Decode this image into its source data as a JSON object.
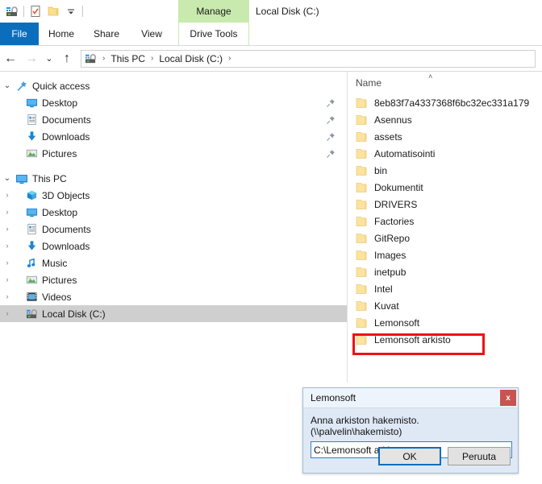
{
  "window": {
    "title": "Local Disk (C:)",
    "contextual_tab_group": "Manage",
    "quick_access_icons": [
      "drive-icon",
      "properties-icon",
      "new-folder-icon",
      "customize-chevron-icon"
    ]
  },
  "ribbon": {
    "tabs": [
      {
        "label": "File",
        "active": true
      },
      {
        "label": "Home",
        "active": false
      },
      {
        "label": "Share",
        "active": false
      },
      {
        "label": "View",
        "active": false
      },
      {
        "label": "Drive Tools",
        "active": false
      }
    ]
  },
  "address_bar": {
    "back_icon": "back-arrow-icon",
    "forward_icon": "forward-arrow-icon",
    "recent_icon": "chevron-down-icon",
    "up_icon": "up-arrow-icon",
    "path_icon": "drive-icon",
    "crumbs": [
      "This PC",
      "Local Disk (C:)"
    ],
    "separator": "›"
  },
  "nav_pane": {
    "groups": [
      {
        "name": "Quick access",
        "icon": "pin-star-icon",
        "expanded": true,
        "items": [
          {
            "label": "Desktop",
            "icon": "desktop-icon",
            "pinned": true
          },
          {
            "label": "Documents",
            "icon": "documents-icon",
            "pinned": true
          },
          {
            "label": "Downloads",
            "icon": "downloads-icon",
            "pinned": true
          },
          {
            "label": "Pictures",
            "icon": "pictures-icon",
            "pinned": true
          }
        ]
      },
      {
        "name": "This PC",
        "icon": "this-pc-icon",
        "expanded": true,
        "items": [
          {
            "label": "3D Objects",
            "icon": "3d-objects-icon",
            "pinned": false
          },
          {
            "label": "Desktop",
            "icon": "desktop-icon",
            "pinned": false
          },
          {
            "label": "Documents",
            "icon": "documents-icon",
            "pinned": false
          },
          {
            "label": "Downloads",
            "icon": "downloads-icon",
            "pinned": false
          },
          {
            "label": "Music",
            "icon": "music-icon",
            "pinned": false
          },
          {
            "label": "Pictures",
            "icon": "pictures-icon",
            "pinned": false
          },
          {
            "label": "Videos",
            "icon": "videos-icon",
            "pinned": false
          },
          {
            "label": "Local Disk (C:)",
            "icon": "drive-icon",
            "pinned": false,
            "selected": true
          }
        ]
      }
    ]
  },
  "file_list": {
    "column_header": "Name",
    "sort_caret": "˄",
    "rows": [
      {
        "name": "8eb83f7a4337368f6bc32ec331a179",
        "icon": "folder-icon"
      },
      {
        "name": "Asennus",
        "icon": "folder-icon"
      },
      {
        "name": "assets",
        "icon": "folder-icon"
      },
      {
        "name": "Automatisointi",
        "icon": "folder-icon"
      },
      {
        "name": "bin",
        "icon": "folder-icon"
      },
      {
        "name": "Dokumentit",
        "icon": "folder-icon"
      },
      {
        "name": "DRIVERS",
        "icon": "folder-icon"
      },
      {
        "name": "Factories",
        "icon": "folder-icon"
      },
      {
        "name": "GitRepo",
        "icon": "folder-icon"
      },
      {
        "name": "Images",
        "icon": "folder-icon"
      },
      {
        "name": "inetpub",
        "icon": "folder-icon"
      },
      {
        "name": "Intel",
        "icon": "folder-icon"
      },
      {
        "name": "Kuvat",
        "icon": "folder-icon"
      },
      {
        "name": "Lemonsoft",
        "icon": "folder-icon"
      },
      {
        "name": "Lemonsoft arkisto",
        "icon": "folder-icon",
        "annotated": true
      }
    ]
  },
  "annotation": {
    "color": "#ee1111",
    "target": "Lemonsoft arkisto"
  },
  "dialog": {
    "title": "Lemonsoft",
    "close_label": "x",
    "prompt": "Anna arkiston hakemisto. (\\\\palvelin\\hakemisto)",
    "input_value": "C:\\Lemonsoft arkisto",
    "input_placeholder": "",
    "ok_label": "OK",
    "cancel_label": "Peruuta"
  },
  "colors": {
    "file_tab": "#0b6ebd",
    "contextual_tab": "#c9eaae",
    "selection": "#cfcfcf",
    "folder": "#fce3a0",
    "dialog_body": "#dfe9f6",
    "close_button": "#c75450",
    "annotation": "#ee1111"
  }
}
